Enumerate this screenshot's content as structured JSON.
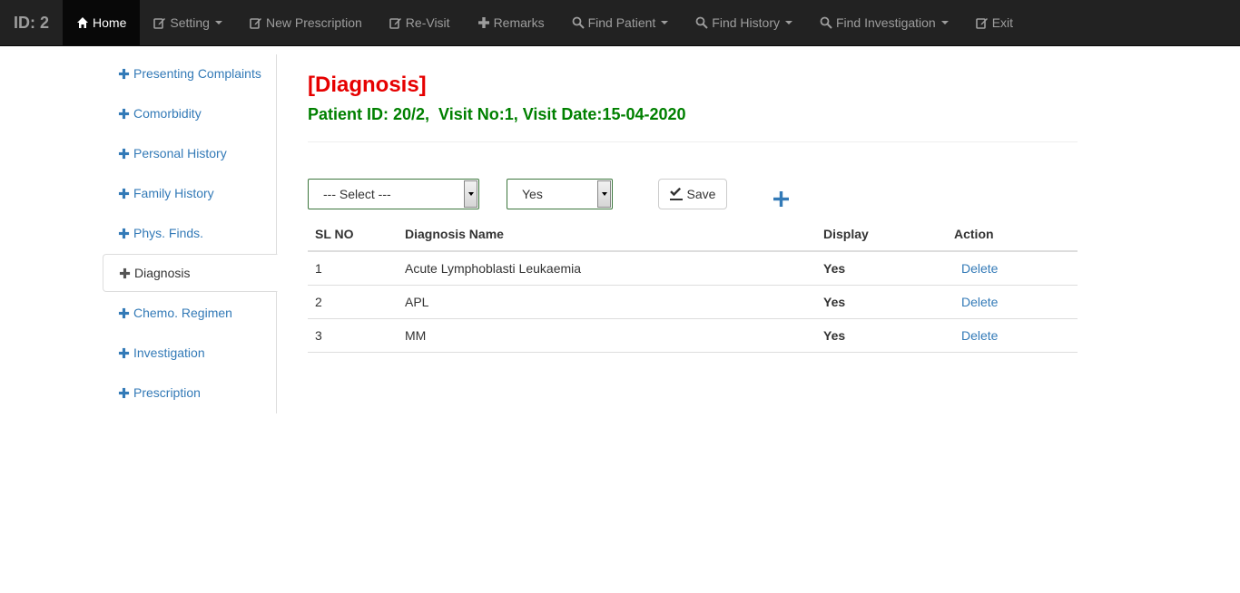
{
  "navbar": {
    "brand": "ID: 2",
    "items": [
      {
        "label": "Home",
        "icon": "home-icon",
        "active": true,
        "dropdown": false
      },
      {
        "label": "Setting",
        "icon": "edit-icon",
        "active": false,
        "dropdown": true
      },
      {
        "label": "New Prescription",
        "icon": "edit-icon",
        "active": false,
        "dropdown": false
      },
      {
        "label": "Re-Visit",
        "icon": "edit-icon",
        "active": false,
        "dropdown": false
      },
      {
        "label": "Remarks",
        "icon": "plus-icon",
        "active": false,
        "dropdown": false
      },
      {
        "label": "Find Patient",
        "icon": "search-icon",
        "active": false,
        "dropdown": true
      },
      {
        "label": "Find History",
        "icon": "search-icon",
        "active": false,
        "dropdown": true
      },
      {
        "label": "Find Investigation",
        "icon": "search-icon",
        "active": false,
        "dropdown": true
      },
      {
        "label": "Exit",
        "icon": "edit-icon",
        "active": false,
        "dropdown": false
      }
    ]
  },
  "sidebar": {
    "items": [
      {
        "label": "Presenting Complaints"
      },
      {
        "label": "Comorbidity"
      },
      {
        "label": "Personal History"
      },
      {
        "label": "Family History"
      },
      {
        "label": "Phys. Finds."
      },
      {
        "label": "Diagnosis"
      },
      {
        "label": "Chemo. Regimen"
      },
      {
        "label": "Investigation"
      },
      {
        "label": "Prescription"
      }
    ],
    "active_index": 5
  },
  "main": {
    "title": "[Diagnosis]",
    "subtitle": "Patient ID: 20/2,  Visit No:1, Visit Date:15-04-2020",
    "diagnosis_select": "--- Select ---",
    "display_select": "Yes",
    "save_label": "Save",
    "table": {
      "headers": [
        "SL NO",
        "Diagnosis Name",
        "Display",
        "Action"
      ],
      "rows": [
        {
          "sl": "1",
          "name": "Acute Lymphoblasti Leukaemia",
          "display": "Yes",
          "action": "Delete"
        },
        {
          "sl": "2",
          "name": "APL",
          "display": "Yes",
          "action": "Delete"
        },
        {
          "sl": "3",
          "name": "MM",
          "display": "Yes",
          "action": "Delete"
        }
      ]
    }
  },
  "colors": {
    "navbar_bg": "#222222",
    "title": "#e60000",
    "subtitle": "#008000",
    "link": "#337ab7",
    "select_border": "#3c763d"
  }
}
